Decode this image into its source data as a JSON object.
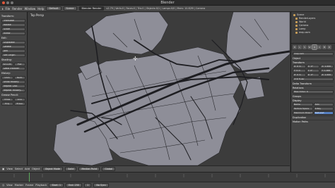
{
  "window": {
    "title": "Blender"
  },
  "menubar": {
    "items": [
      "File",
      "Render",
      "Window",
      "Help"
    ],
    "layout": "Default",
    "scene": "Scene",
    "engine": "Blender Render",
    "stats": "v2.79 | Verts:0 | Faces:0 | Tris:0 | Objects:0/1 | Lamps:0/0 | Mem: 10.82M | Camera"
  },
  "left_panel": {
    "transform": "Transform:",
    "buttons": [
      "Translate",
      "Rotate",
      "Scale",
      "Mirror"
    ],
    "edit": "Edit:",
    "edit_buttons": [
      "Duplicate",
      "Delete",
      "Join",
      "Set Origin"
    ],
    "shading": "Shading:",
    "shading_buttons": [
      "Smooth",
      "Flat"
    ],
    "data_transfer": "Data Transfer",
    "history": "History:",
    "history_buttons": [
      "Undo",
      "Redo",
      "Undo History",
      "Repeat Last",
      "Repeat History..."
    ],
    "grease_pencil": "Grease Pencil:",
    "gp_buttons": [
      "Draw",
      "Line",
      "Poly",
      "Erase"
    ]
  },
  "viewport": {
    "label": "Top Persp"
  },
  "viewport_toolbar": {
    "items": [
      "View",
      "Select",
      "Add",
      "Object"
    ],
    "mode": "Object Mode",
    "shading": "Solid",
    "pivot": "Median Point",
    "layer": "Global"
  },
  "outliner": {
    "items": [
      "Scene",
      "RenderLayers",
      "World",
      "Camera",
      "Lamp",
      "map.osm"
    ]
  },
  "properties": {
    "tabs": [
      "R",
      "L",
      "S",
      "W",
      "O",
      "C",
      "M",
      "D",
      "P",
      "T"
    ],
    "object_name": "map.osm",
    "sections": [
      "Object",
      "Transform",
      "Delta Transform",
      "Relations",
      "Groups",
      "Display",
      "Duplication",
      "Relations Extras",
      "Motion Paths",
      "Custom Properties"
    ],
    "location": "Location:",
    "loc": [
      "X: 0 m",
      "Y: 0 m",
      "Z: 0 m"
    ],
    "rotation": "Rotation:",
    "rot": [
      "X: 0°",
      "Y: 0°",
      "Z: 0°"
    ],
    "scale": "Scale:",
    "sca": [
      "X: 1.000",
      "Y: 1.000",
      "Z: 1.000"
    ],
    "rotation_mode": "XYZ Euler",
    "parent": "Parent:",
    "pass_index": "Pass Index: 0",
    "layers": "Layers:",
    "name_label": "Name",
    "axis": "Axis",
    "texture_space": "Texture Space",
    "x_ray": "X-Ray",
    "draw_all_edges": "Draw All Edges",
    "max_draw_type": "Maximum Draw Type:",
    "max_draw_value": "Textured",
    "object_color": "Object Color:"
  },
  "timeline_toolbar": {
    "items": [
      "View",
      "Marker",
      "Frame",
      "Playback"
    ],
    "start": "Start: 1",
    "end": "End: 250",
    "current": "1",
    "sync": "No Sync"
  },
  "colors": {
    "building": "#8e8e98",
    "road": "#1e1e22",
    "viewport_bg": "#3c3c3c",
    "accent": "#5680c2"
  }
}
